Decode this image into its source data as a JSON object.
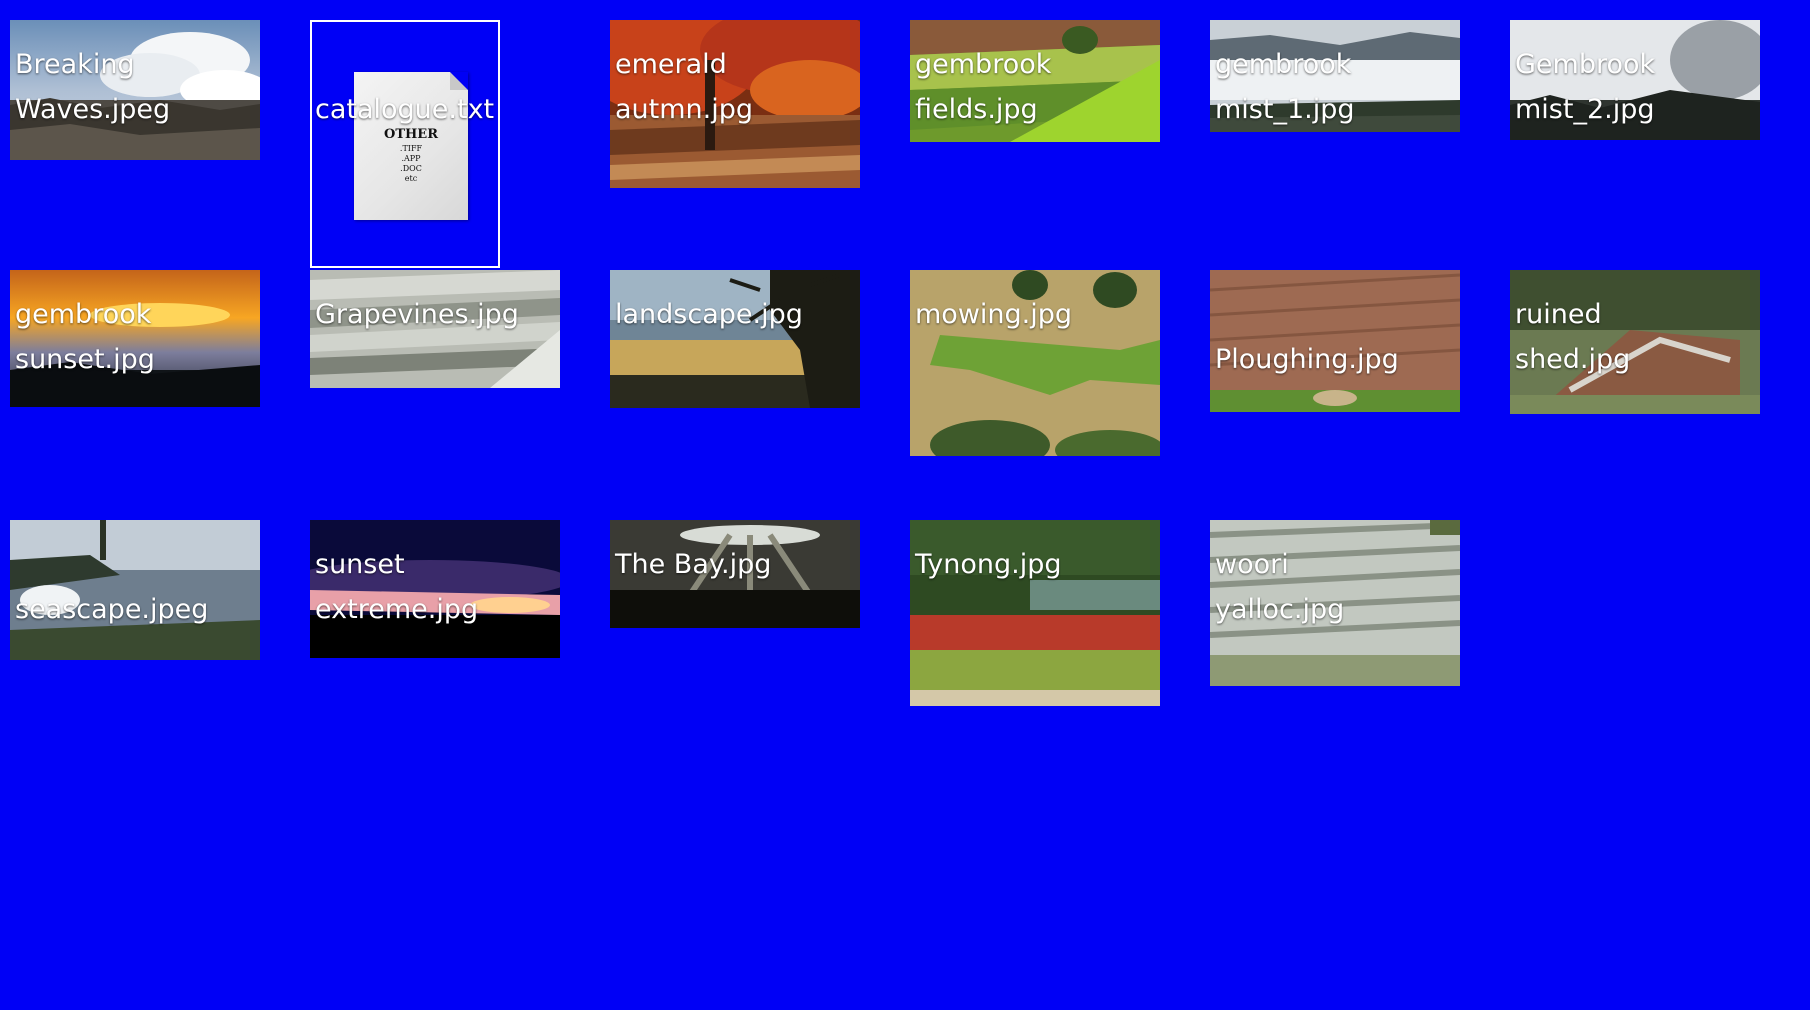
{
  "desktop": {
    "background_color": "#0000f6",
    "files": [
      {
        "label": "Breaking\nWaves.jpeg",
        "icon": "photo-thumbnail-breaking-waves",
        "kind": "image"
      },
      {
        "label": "catalogue.txt",
        "icon": "text-document-icon",
        "kind": "text",
        "selected": true,
        "doc_preview": {
          "title": "OTHER",
          "lines": [
            ".TIFF",
            ".APP",
            ".DOC",
            "etc"
          ]
        }
      },
      {
        "label": "emerald\nautmn.jpg",
        "icon": "photo-thumbnail-emerald-autumn",
        "kind": "image"
      },
      {
        "label": "gembrook\nfields.jpg",
        "icon": "photo-thumbnail-gembrook-fields",
        "kind": "image"
      },
      {
        "label": "gembrook\nmist_1.jpg",
        "icon": "photo-thumbnail-gembrook-mist-1",
        "kind": "image"
      },
      {
        "label": "Gembrook\nmist_2.jpg",
        "icon": "photo-thumbnail-gembrook-mist-2",
        "kind": "image"
      },
      {
        "label": "gembrook\nsunset.jpg",
        "icon": "photo-thumbnail-gembrook-sunset",
        "kind": "image"
      },
      {
        "label": "Grapevines.jpg",
        "icon": "photo-thumbnail-grapevines",
        "kind": "image"
      },
      {
        "label": "landscape.jpg",
        "icon": "photo-thumbnail-landscape",
        "kind": "image"
      },
      {
        "label": "mowing.jpg",
        "icon": "photo-thumbnail-mowing",
        "kind": "image"
      },
      {
        "label": "Ploughing.jpg",
        "icon": "photo-thumbnail-ploughing",
        "kind": "image"
      },
      {
        "label": "ruined\nshed.jpg",
        "icon": "photo-thumbnail-ruined-shed",
        "kind": "image"
      },
      {
        "label": "seascape.jpeg",
        "icon": "photo-thumbnail-seascape",
        "kind": "image"
      },
      {
        "label": "sunset\nextreme.jpg",
        "icon": "photo-thumbnail-sunset-extreme",
        "kind": "image"
      },
      {
        "label": "The Bay.jpg",
        "icon": "photo-thumbnail-the-bay",
        "kind": "image"
      },
      {
        "label": "Tynong.jpg",
        "icon": "photo-thumbnail-tynong",
        "kind": "image"
      },
      {
        "label": "woori\nyalloc.jpg",
        "icon": "photo-thumbnail-woori-yalloc",
        "kind": "image"
      }
    ]
  }
}
